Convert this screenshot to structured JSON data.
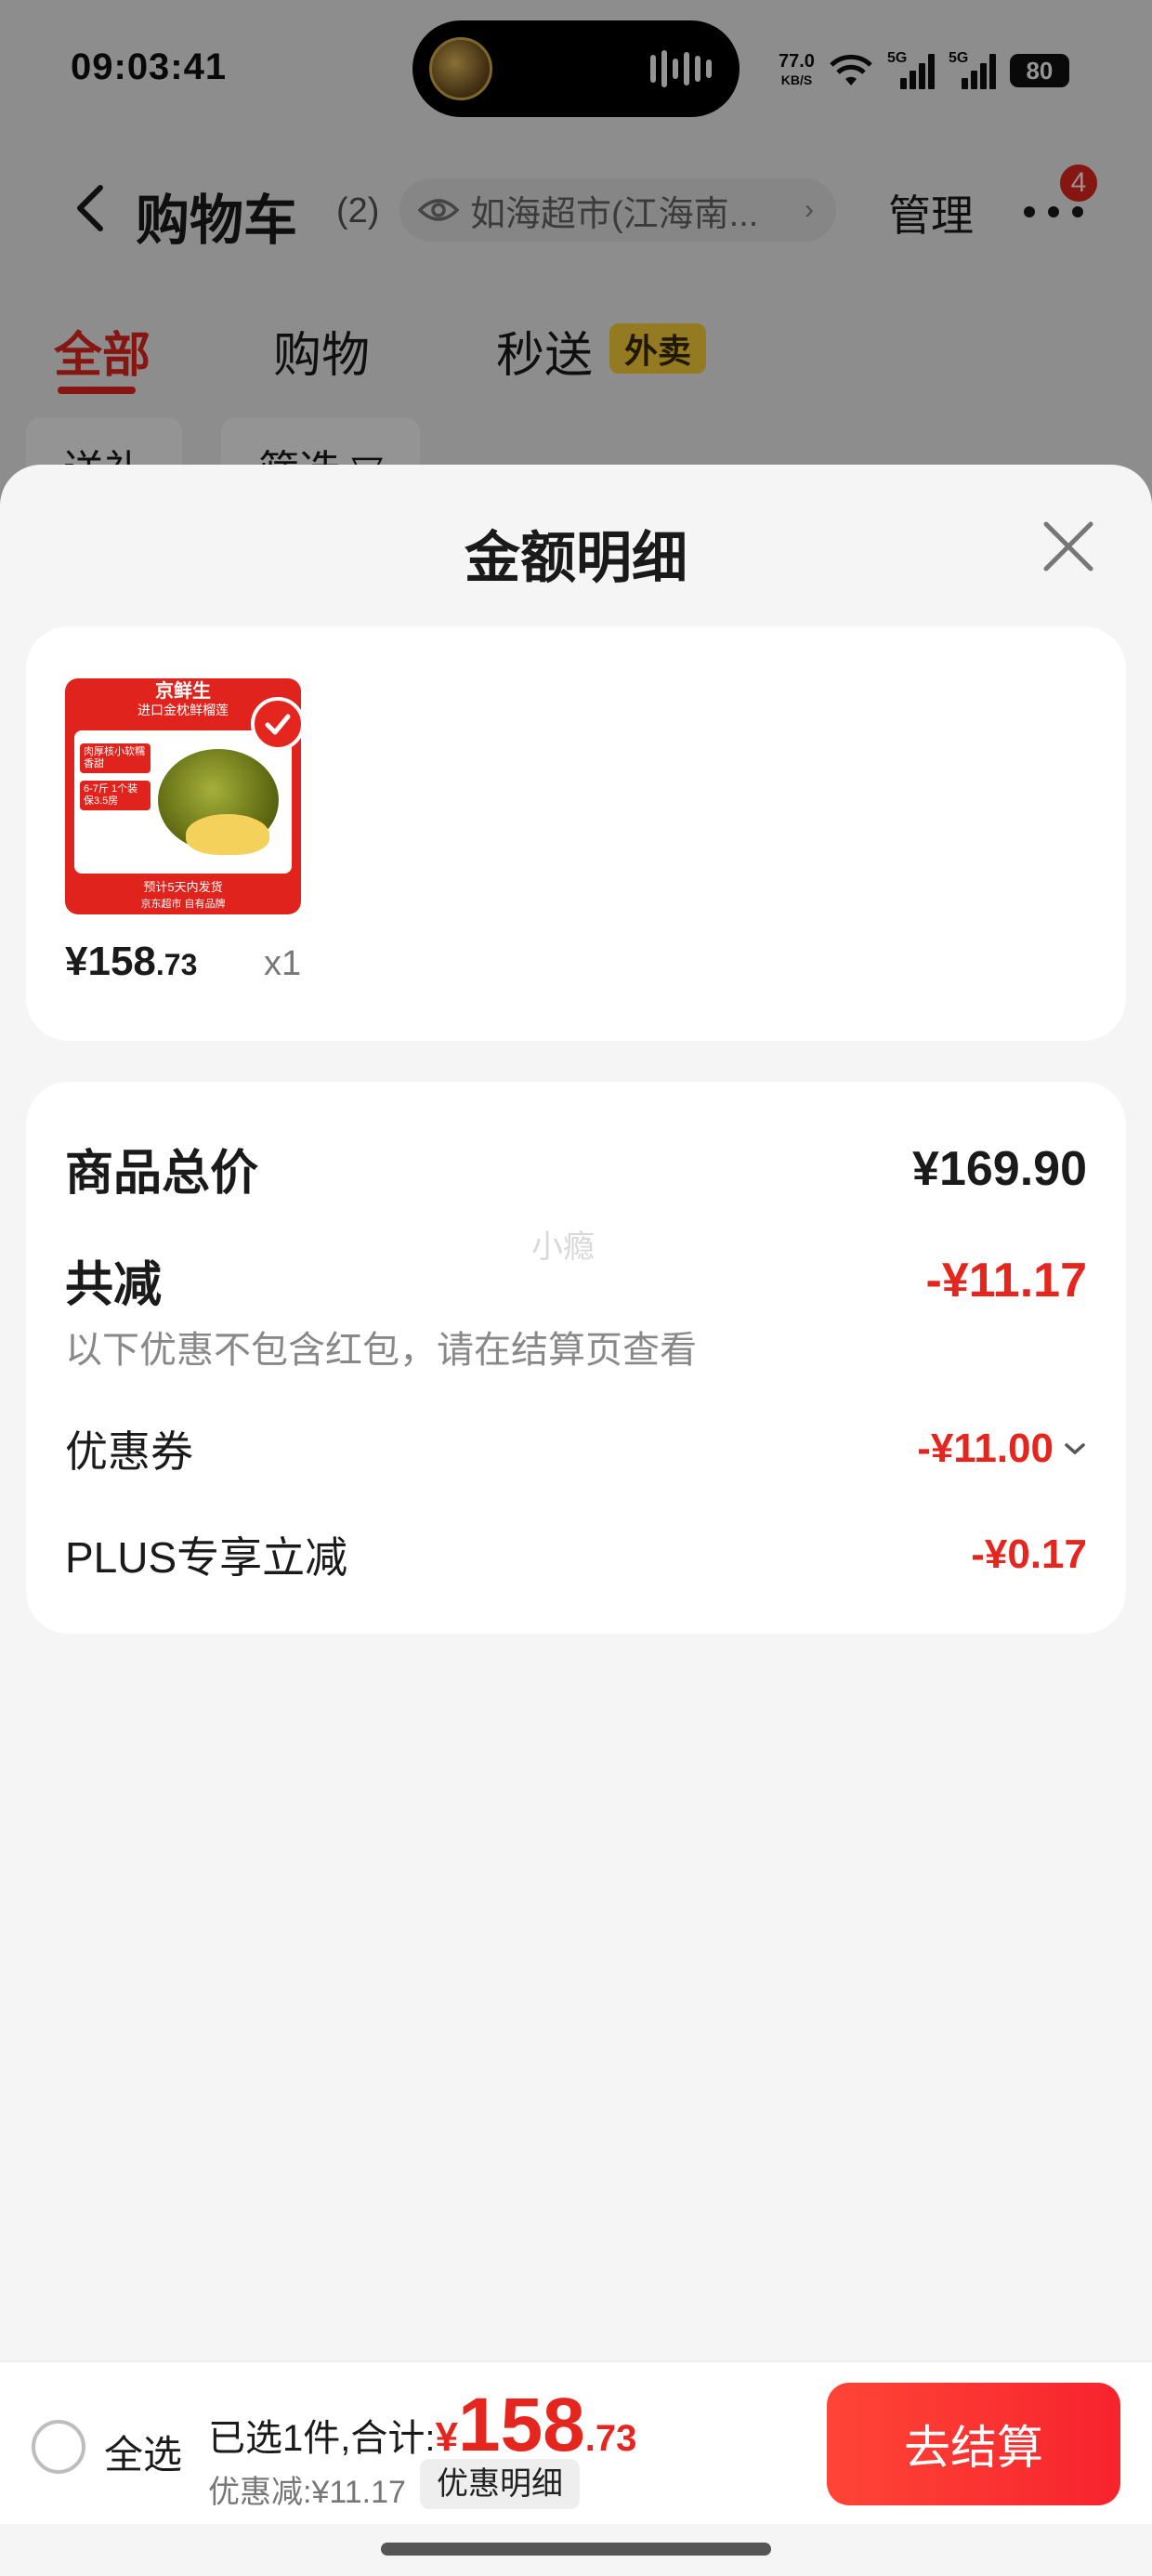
{
  "status_bar": {
    "time": "09:03:41",
    "net_speed": "77.0",
    "net_unit": "KB/S",
    "sig1": "5G",
    "sig2": "5G",
    "battery": "80"
  },
  "nav": {
    "title": "购物车",
    "count": "(2)",
    "store": "如海超市(江海南...",
    "manage": "管理",
    "badge": "4"
  },
  "tabs": [
    {
      "label": "全部"
    },
    {
      "label": "购物"
    },
    {
      "label": "秒送"
    }
  ],
  "waimai_badge": "外卖",
  "chips": [
    {
      "label": "送礼"
    },
    {
      "label": "筛选 ▽"
    }
  ],
  "sheet": {
    "title": "金额明细",
    "item": {
      "thumb_brand": "京鲜生",
      "thumb_sub": "进口金枕鲜榴莲",
      "thumb_tag1": "肉厚核小软糯香甜",
      "thumb_tag2": "6-7斤 1个装 保3.5房",
      "thumb_foot1": "预计5天内发货",
      "thumb_foot2": "京东超市 自有品牌",
      "price_yen": "¥158",
      "price_dec": ".73",
      "qty": "x1"
    },
    "summary": {
      "total_label": "商品总价",
      "total_value": "¥169.90",
      "reduce_label": "共减",
      "reduce_value": "-¥11.17",
      "note": "以下优惠不包含红包，请在结算页查看",
      "coupon_label": "优惠券",
      "coupon_value": "-¥11.00",
      "plus_label": "PLUS专享立减",
      "plus_value": "-¥0.17",
      "watermark": "小瘾"
    }
  },
  "footer": {
    "select_all": "全选",
    "selected_label": "已选1件,合计:",
    "total_yen": "¥",
    "total_int": "158",
    "total_dec": ".73",
    "discount": "优惠减:¥11.17",
    "detail_button": "优惠明细",
    "checkout": "去结算"
  },
  "colors": {
    "accent": "#e5261f",
    "badge_yellow": "#ffd23a"
  }
}
